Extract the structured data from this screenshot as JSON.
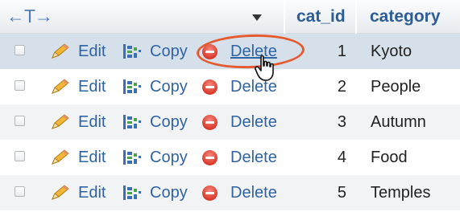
{
  "header": {
    "arrows_glyph": "←T→",
    "sort_icon": "triangle-down-icon",
    "col_id": "cat_id",
    "col_category": "category"
  },
  "actions": {
    "edit_label": "Edit",
    "copy_label": "Copy",
    "delete_label": "Delete"
  },
  "rows": [
    {
      "cat_id": "1",
      "category": "Kyoto"
    },
    {
      "cat_id": "2",
      "category": "People"
    },
    {
      "cat_id": "3",
      "category": "Autumn"
    },
    {
      "cat_id": "4",
      "category": "Food"
    },
    {
      "cat_id": "5",
      "category": "Temples"
    }
  ],
  "state": {
    "hovered_row": 1,
    "hovered_action": "delete"
  },
  "colors": {
    "link": "#2f63a4",
    "header_text": "#2d5d96",
    "highlight_ring": "#e65a2e",
    "hover_row": "#d6e0ea"
  }
}
